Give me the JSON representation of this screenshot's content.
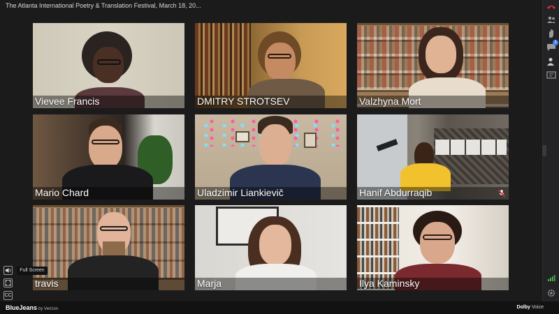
{
  "meeting": {
    "title": "The Atlanta International Poetry & Translation Festival, March 18, 20..."
  },
  "tiles": [
    {
      "name": "Vievee Francis"
    },
    {
      "name": "DMITRY STROTSEV"
    },
    {
      "name": "Valzhyna Mort"
    },
    {
      "name": "Mario Chard"
    },
    {
      "name": "Uladzimir Liankievič"
    },
    {
      "name": "Hanif Abdurraqib"
    },
    {
      "name": "travis"
    },
    {
      "name": "Marja"
    },
    {
      "name": "Ilya Kaminsky"
    }
  ],
  "controls": {
    "fullscreen_tooltip": "Full Screen",
    "cc_label": "CC"
  },
  "right_rail": {
    "chat_badge": "1"
  },
  "footer": {
    "brand": "BlueJeans",
    "brand_by": "by Verizon",
    "dolby_brand": "Dolby",
    "dolby_suffix": "Voice"
  },
  "colors": {
    "end_call": "#e0313a",
    "chat_badge": "#3b82f6",
    "muted": "#e0313a",
    "network_good": "#4caf50"
  }
}
